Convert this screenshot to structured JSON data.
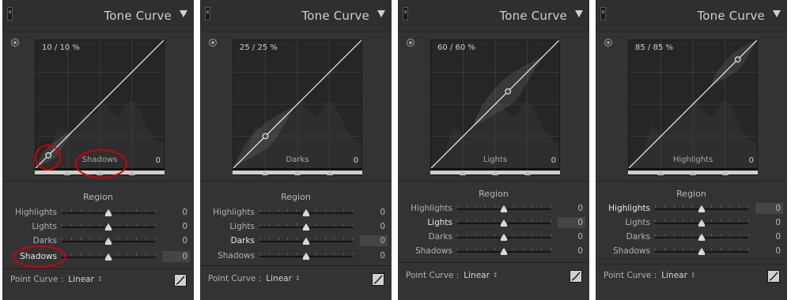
{
  "panels": [
    {
      "title": "Tone Curve",
      "readout": "10 / 10 %",
      "graph_region_label": "Shadows",
      "graph_value": "0",
      "active_region": "Shadows",
      "control_point": 0.1,
      "region_title": "Region",
      "sliders": [
        {
          "label": "Highlights",
          "value": "0"
        },
        {
          "label": "Lights",
          "value": "0"
        },
        {
          "label": "Darks",
          "value": "0"
        },
        {
          "label": "Shadows",
          "value": "0"
        }
      ],
      "point_curve_label": "Point Curve :",
      "point_curve_value": "Linear"
    },
    {
      "title": "Tone Curve",
      "readout": "25 / 25 %",
      "graph_region_label": "Darks",
      "graph_value": "0",
      "active_region": "Darks",
      "control_point": 0.25,
      "region_title": "Region",
      "sliders": [
        {
          "label": "Highlights",
          "value": "0"
        },
        {
          "label": "Lights",
          "value": "0"
        },
        {
          "label": "Darks",
          "value": "0"
        },
        {
          "label": "Shadows",
          "value": "0"
        }
      ],
      "point_curve_label": "Point Curve :",
      "point_curve_value": "Linear"
    },
    {
      "title": "Tone Curve",
      "readout": "60 / 60 %",
      "graph_region_label": "Lights",
      "graph_value": "0",
      "active_region": "Lights",
      "control_point": 0.6,
      "region_title": "Region",
      "sliders": [
        {
          "label": "Highlights",
          "value": "0"
        },
        {
          "label": "Lights",
          "value": "0"
        },
        {
          "label": "Darks",
          "value": "0"
        },
        {
          "label": "Shadows",
          "value": "0"
        }
      ],
      "point_curve_label": "Point Curve :",
      "point_curve_value": "Linear"
    },
    {
      "title": "Tone Curve",
      "readout": "85 / 85 %",
      "graph_region_label": "Highlights",
      "graph_value": "0",
      "active_region": "Highlights",
      "control_point": 0.85,
      "region_title": "Region",
      "sliders": [
        {
          "label": "Highlights",
          "value": "0"
        },
        {
          "label": "Lights",
          "value": "0"
        },
        {
          "label": "Darks",
          "value": "0"
        },
        {
          "label": "Shadows",
          "value": "0"
        }
      ],
      "point_curve_label": "Point Curve :",
      "point_curve_value": "Linear"
    }
  ],
  "split_points": [
    0.25,
    0.5,
    0.75
  ],
  "colors": {
    "panel_bg": "#333333",
    "curve": "#e6e6e6",
    "annotation": "#d30000"
  },
  "icons": {
    "panel_grip": "panel-grip-icon",
    "disclosure": "triangle-down-icon",
    "targeted_adjustment": "target-icon",
    "curve_button": "point-curve-icon"
  }
}
